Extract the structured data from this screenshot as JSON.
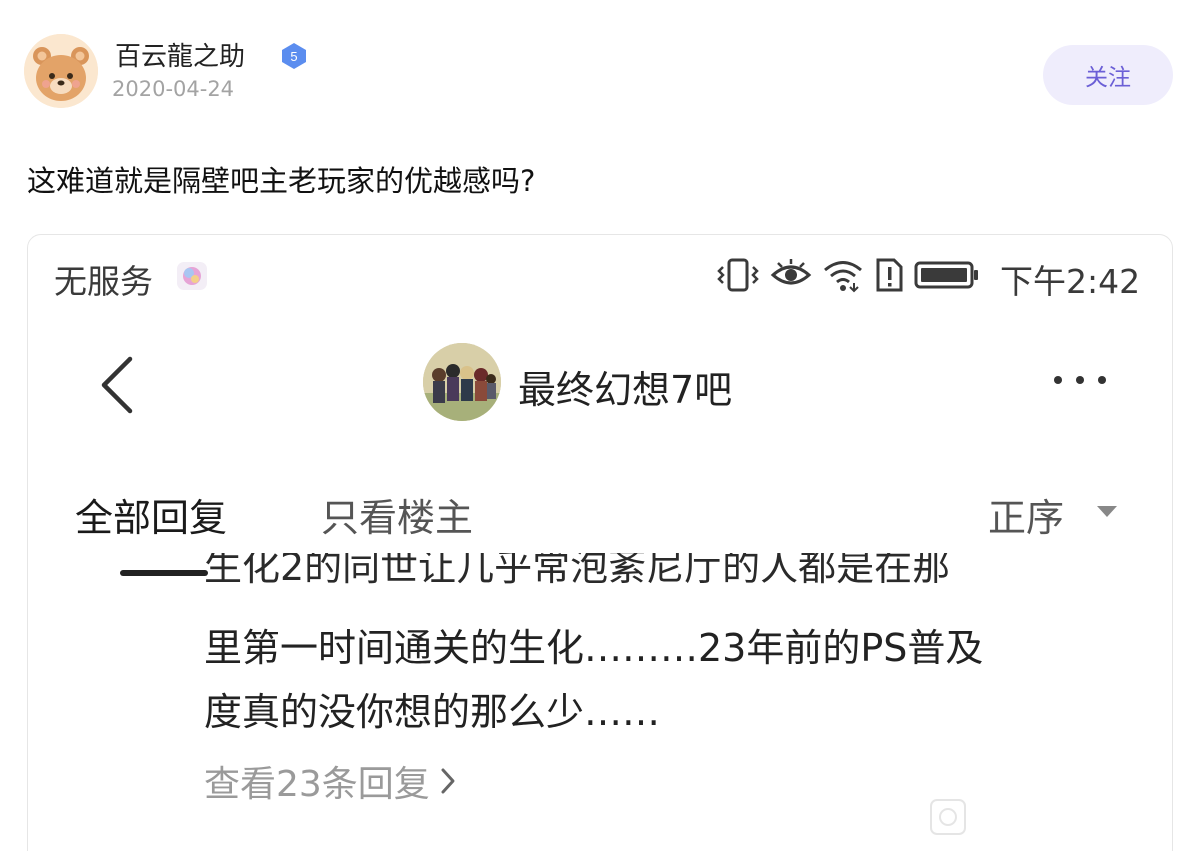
{
  "post": {
    "author": {
      "name": "百云龍之助",
      "level": "5",
      "avatar_icon": "bear-avatar"
    },
    "date": "2020-04-24",
    "follow_label": "关注",
    "text": "这难道就是隔壁吧主老玩家的优越感吗?"
  },
  "screenshot": {
    "status_bar": {
      "carrier": "无服务",
      "icons": [
        "vibrate-icon",
        "eye-icon",
        "wifi-icon",
        "sim-alert-icon",
        "battery-icon"
      ],
      "time": "下午2:42"
    },
    "nav": {
      "back_icon": "chevron-left-icon",
      "forum_title": "最终幻想7吧",
      "more_icon": "more-icon"
    },
    "tabs": {
      "all": "全部回复",
      "owner_only": "只看楼主",
      "sort": "正序"
    },
    "reply": {
      "clipped_line": "生化2的同世让几乎常泡紊尼厅的人都是在那",
      "line1": "里第一时间通关的生化………23年前的PS普及",
      "line2": "度真的没你想的那么少……",
      "view_more": "查看23条回复"
    }
  },
  "colors": {
    "follow_bg": "#efedfc",
    "follow_text": "#6b5fd6",
    "badge": "#5b8def",
    "muted": "#a3a3a3"
  }
}
